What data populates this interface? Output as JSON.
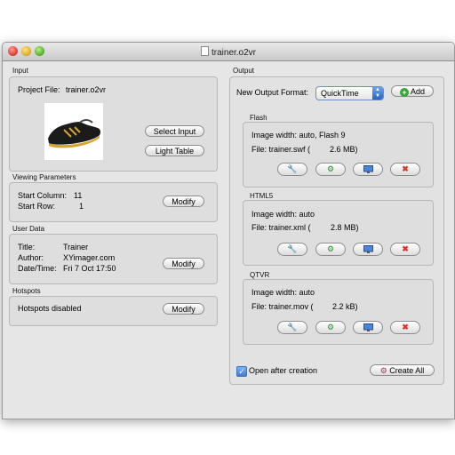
{
  "window": {
    "title": "trainer.o2vr"
  },
  "input": {
    "section_label": "Input",
    "project_file_label": "Project File:",
    "project_file_value": "trainer.o2vr",
    "select_input_label": "Select Input",
    "light_table_label": "Light Table"
  },
  "viewing": {
    "section_label": "Viewing Parameters",
    "start_column_label": "Start Column:",
    "start_column_value": "11",
    "start_row_label": "Start Row:",
    "start_row_value": "1",
    "modify_label": "Modify"
  },
  "user_data": {
    "section_label": "User Data",
    "title_label": "Title:",
    "title_value": "Trainer",
    "author_label": "Author:",
    "author_value": "XYimager.com",
    "datetime_label": "Date/Time:",
    "datetime_value": "Fri 7 Oct 17:50",
    "modify_label": "Modify"
  },
  "hotspots": {
    "section_label": "Hotspots",
    "status": "Hotspots disabled",
    "modify_label": "Modify"
  },
  "output": {
    "section_label": "Output",
    "new_format_label": "New Output Format:",
    "format_selected": "QuickTime",
    "add_label": "Add",
    "formats": [
      {
        "name": "Flash",
        "image_width": "Image width: auto, Flash 9",
        "file": "File: trainer.swf (",
        "size": "2.6 MB)"
      },
      {
        "name": "HTML5",
        "image_width": "Image width: auto",
        "file": "File: trainer.xml (",
        "size": "2.8 MB)"
      },
      {
        "name": "QTVR",
        "image_width": "Image width: auto",
        "file": "File: trainer.mov (",
        "size": "2.2 kB)"
      }
    ],
    "open_after_label": "Open after creation",
    "open_after_checked": true,
    "create_all_label": "Create All"
  },
  "icons": [
    "wrench-icon",
    "gears-icon",
    "monitor-icon",
    "delete-icon",
    "plus-icon",
    "document-icon"
  ],
  "colors": {
    "window_bg": "#e6e6e6",
    "box_bg": "#dedede",
    "accent": "#3f7ad6",
    "delete_red": "#d9362b",
    "add_green": "#36a332"
  }
}
